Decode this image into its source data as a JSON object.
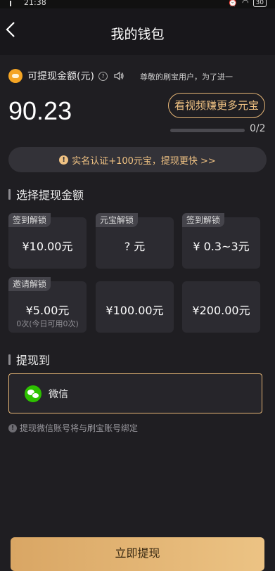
{
  "status_bar": {
    "time": "21:38",
    "battery": "30"
  },
  "header": {
    "title": "我的钱包"
  },
  "balance": {
    "label": "可提现金额(元)",
    "notice": "尊敬的刷宝用户，为了进一",
    "amount": "90.23",
    "video_button": "看视频赚更多元宝",
    "progress_text": "0/2",
    "progress_fraction": 0
  },
  "verify_banner": "实名认证+100元宝，提现更快 >>",
  "select_section": {
    "title": "选择提现金额",
    "options": [
      {
        "tag": "签到解锁",
        "value": "¥10.00元",
        "sub": ""
      },
      {
        "tag": "元宝解锁",
        "value": "? 元",
        "sub": ""
      },
      {
        "tag": "签到解锁",
        "value": "¥ 0.3~3元",
        "sub": ""
      },
      {
        "tag": "邀请解锁",
        "value": "¥5.00元",
        "sub": "0次(今日可用0次)"
      },
      {
        "tag": "",
        "value": "¥100.00元",
        "sub": ""
      },
      {
        "tag": "",
        "value": "¥200.00元",
        "sub": ""
      }
    ]
  },
  "withdraw_section": {
    "title": "提现到",
    "method": "微信",
    "tip": "提现微信账号将与刷宝账号绑定"
  },
  "submit_button": "立即提现",
  "colors": {
    "accent_gold": "#e6b676",
    "background": "#1f1e22",
    "wechat_green": "#2dc100"
  }
}
